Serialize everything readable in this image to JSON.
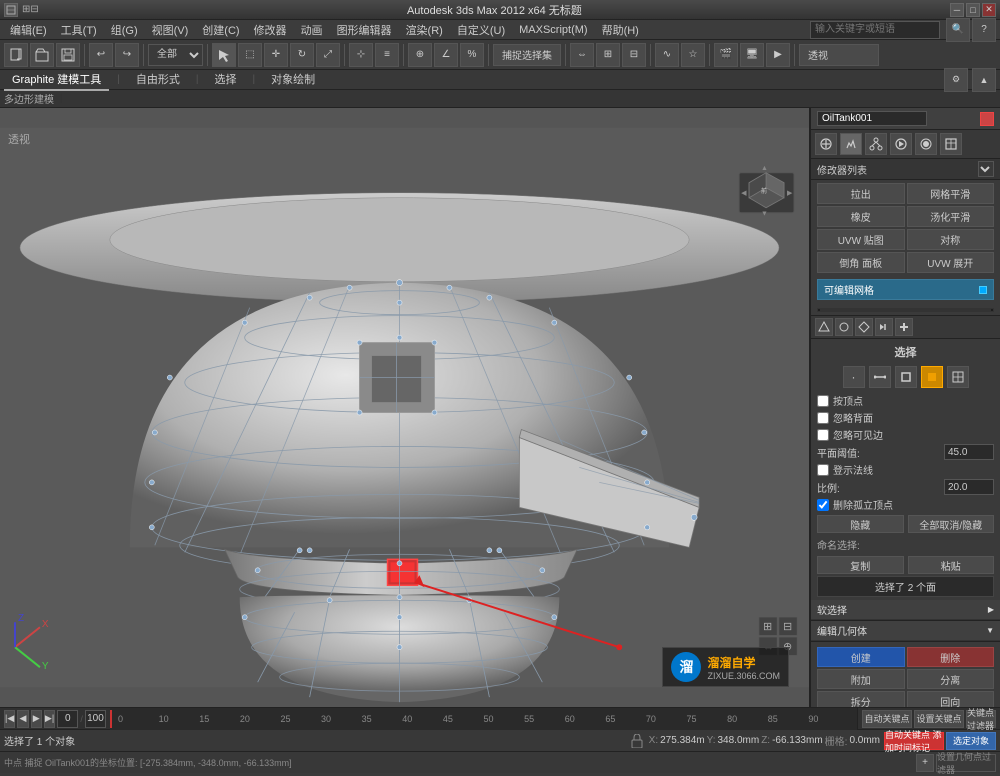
{
  "titlebar": {
    "title": "Autodesk 3ds Max 2012 x64  无标题",
    "buttons": [
      "minimize",
      "maximize",
      "close"
    ]
  },
  "menubar": {
    "items": [
      "编辑(E)",
      "工具(T)",
      "组(G)",
      "视图(V)",
      "创建(C)",
      "修改器",
      "动画",
      "图形编辑器",
      "渲染(R)",
      "自定义(U)",
      "MAXScript(M)",
      "帮助(H)"
    ]
  },
  "toolbar": {
    "select_dropdown": "全部",
    "snap_btn": "捕捉选择集",
    "viewport_label": "透视"
  },
  "ribbon": {
    "tabs": [
      "Graphite 建模工具",
      "自由形式",
      "选择",
      "对象绘制"
    ]
  },
  "subribbon": {
    "items": [
      "多边形建模"
    ]
  },
  "rightpanel": {
    "obj_name": "OilTank001",
    "mod_list_label": "修改器列表",
    "mod_buttons": [
      {
        "label": "拉出",
        "label2": "网格平滑"
      },
      {
        "label": "橡皮",
        "label2": "汤化平滑"
      },
      {
        "label": "UVW 贴图",
        "label2": "对称"
      },
      {
        "label": "倒角 面板",
        "label2": "UVW 展开"
      }
    ],
    "mod_list_item": "可编辑网格",
    "select_section": {
      "title": "选择",
      "icons": [
        "·",
        "△",
        "□",
        "◇",
        "⬡"
      ],
      "active_icon": 3,
      "checkboxes": [
        {
          "label": "按顶点",
          "checked": false
        },
        {
          "label": "忽略背面",
          "checked": false
        },
        {
          "label": "忽略可见边",
          "checked": false
        },
        {
          "label": "登示法线",
          "checked": false
        },
        {
          "label": "删除孤立顶点",
          "checked": true
        }
      ],
      "num_fields": [
        {
          "label": "平面阈值:",
          "value": "45.0"
        },
        {
          "label": "比例:",
          "value": "20.0"
        }
      ],
      "buttons": [
        {
          "label": "隐藏",
          "label2": "全部取消/隐藏"
        },
        {
          "label": "命名选择:"
        },
        {
          "label": "复制",
          "label2": "粘贴"
        },
        {
          "label": "选择了 2 个面"
        }
      ]
    },
    "soft_select": {
      "title": "软选择",
      "label": "编辑几何体"
    },
    "edit_section": {
      "title": "编辑几何体",
      "buttons": [
        {
          "label": "创建",
          "type": "blue"
        },
        {
          "label": "删除",
          "type": "red"
        },
        {
          "label": "附加",
          "type": "normal"
        },
        {
          "label": "分离",
          "type": "normal"
        },
        {
          "label": "拆分",
          "type": "normal"
        },
        {
          "label": "回向",
          "type": "normal"
        }
      ]
    }
  },
  "statusbar": {
    "left_text": "选择了 1 个对象",
    "coords": {
      "x_label": "X:",
      "x_value": "275.384m",
      "y_label": "Y:",
      "y_value": "348.0mm",
      "z_label": "Z:",
      "z_value": "-66.133mm",
      "grid_label": "栅格:",
      "grid_value": "0.0mm"
    },
    "right_text": "自动关键点 添加时间标记",
    "action_btn": "选定对象"
  },
  "bottombar": {
    "left_text": "中点 捕捉 OilTank001的坐标位置: [-275.384mm, -348.0mm, -66.133mm]"
  },
  "timeline": {
    "numbers": [
      "0",
      "10",
      "15",
      "20",
      "25",
      "30",
      "35",
      "40",
      "45",
      "50",
      "55",
      "60",
      "65",
      "70",
      "75",
      "80",
      "85",
      "90"
    ],
    "current": "0",
    "total": "100"
  },
  "watermark": {
    "logo_text": "溜",
    "line1": "溜溜自学",
    "line2": "ZIXUE.3066.COM"
  },
  "viewport_corner_label": "透视",
  "gizmo": {
    "x": "X",
    "y": "Y",
    "z": "Z"
  },
  "icons": {
    "search_icon": "🔍",
    "gear_icon": "⚙",
    "minimize_icon": "─",
    "maximize_icon": "□",
    "close_icon": "✕",
    "arrow_right": "▶",
    "arrow_left": "◀",
    "arrow_down": "▼"
  }
}
